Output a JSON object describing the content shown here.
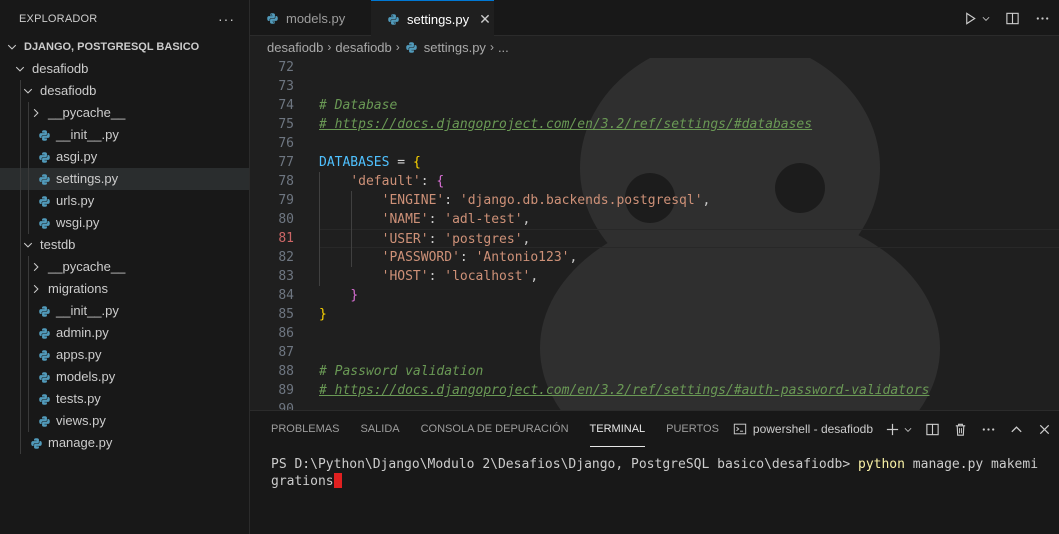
{
  "sidebar": {
    "title": "EXPLORADOR",
    "more": "···",
    "root": "DJANGO, POSTGRESQL BASICO",
    "items": [
      {
        "label": "desafiodb",
        "type": "folder",
        "depth": 1,
        "expanded": true
      },
      {
        "label": "desafiodb",
        "type": "folder",
        "depth": 2,
        "expanded": true
      },
      {
        "label": "__pycache__",
        "type": "folder",
        "depth": 3,
        "expanded": false
      },
      {
        "label": "__init__.py",
        "type": "file",
        "depth": 3
      },
      {
        "label": "asgi.py",
        "type": "file",
        "depth": 3
      },
      {
        "label": "settings.py",
        "type": "file",
        "depth": 3,
        "selected": true
      },
      {
        "label": "urls.py",
        "type": "file",
        "depth": 3
      },
      {
        "label": "wsgi.py",
        "type": "file",
        "depth": 3
      },
      {
        "label": "testdb",
        "type": "folder",
        "depth": 2,
        "expanded": true
      },
      {
        "label": "__pycache__",
        "type": "folder",
        "depth": 3,
        "expanded": false
      },
      {
        "label": "migrations",
        "type": "folder",
        "depth": 3,
        "expanded": false
      },
      {
        "label": "__init__.py",
        "type": "file",
        "depth": 3
      },
      {
        "label": "admin.py",
        "type": "file",
        "depth": 3
      },
      {
        "label": "apps.py",
        "type": "file",
        "depth": 3
      },
      {
        "label": "models.py",
        "type": "file",
        "depth": 3
      },
      {
        "label": "tests.py",
        "type": "file",
        "depth": 3
      },
      {
        "label": "views.py",
        "type": "file",
        "depth": 3
      },
      {
        "label": "manage.py",
        "type": "file",
        "depth": 2
      }
    ]
  },
  "tabs": [
    {
      "label": "models.py",
      "active": false
    },
    {
      "label": "settings.py",
      "active": true,
      "close": "✕"
    }
  ],
  "breadcrumb": {
    "parts": [
      "desafiodb",
      "desafiodb"
    ],
    "file": "settings.py",
    "tail": "..."
  },
  "editor": {
    "line_numbers": [
      "72",
      "73",
      "74",
      "75",
      "76",
      "77",
      "78",
      "79",
      "80",
      "81",
      "82",
      "83",
      "84",
      "85",
      "86",
      "87",
      "88",
      "89",
      "90"
    ],
    "current_line": "81",
    "code": {
      "comment_db": "# Database",
      "url_db": "# https://docs.djangoproject.com/en/3.2/ref/settings/#databases",
      "var": "DATABASES",
      "assign": " = ",
      "open_brace": "{",
      "default_key": "'default'",
      "colon": ": ",
      "inner_open": "{",
      "engine_key": "'ENGINE'",
      "engine_val": "'django.db.backends.postgresql'",
      "name_key": "'NAME'",
      "name_val": "'adl-test'",
      "user_key": "'USER'",
      "user_val": "'postgres'",
      "password_key": "'PASSWORD'",
      "password_val": "'Antonio123'",
      "host_key": "'HOST'",
      "host_val": "'localhost'",
      "comma": ",",
      "inner_close": "}",
      "outer_close": "}",
      "comment_pw": "# Password validation",
      "url_pw": "# https://docs.djangoproject.com/en/3.2/ref/settings/#auth-password-validators"
    }
  },
  "panel": {
    "tabs": [
      "PROBLEMAS",
      "SALIDA",
      "CONSOLA DE DEPURACIÓN",
      "TERMINAL",
      "PUERTOS"
    ],
    "active_tab": "TERMINAL",
    "terminal_name": "powershell - desafiodb",
    "prompt": "PS D:\\Python\\Django\\Modulo 2\\Desafios\\Django, PostgreSQL basico\\desafiodb> ",
    "command": "python",
    "args": " manage.py makemigrations"
  },
  "colors": {
    "accent": "#0078d4",
    "comment": "#6a9955",
    "string": "#ce9178",
    "variable": "#4fc1ff",
    "bracket_gold": "#ffd700",
    "bracket_purple": "#da70d6",
    "python_icon": "#519aba",
    "terminal_cursor": "#e02020"
  }
}
